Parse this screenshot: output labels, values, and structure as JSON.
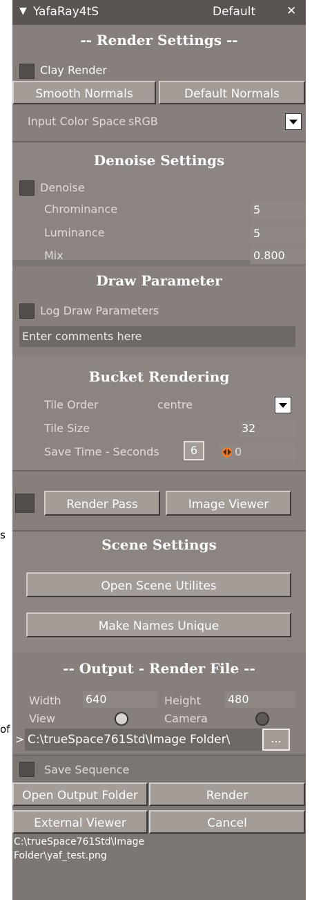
{
  "titlebar": {
    "title": "YafaRay4tS",
    "preset": "Default",
    "close": "✕"
  },
  "stray": {
    "s": "s",
    "of": "of"
  },
  "render_settings": {
    "header": "-- Render Settings --",
    "clay_render": "Clay Render",
    "smooth_normals": "Smooth Normals",
    "default_normals": "Default Normals",
    "input_color_space_label": "Input Color Space",
    "input_color_space_value": "sRGB"
  },
  "denoise": {
    "header": "Denoise Settings",
    "denoise_label": "Denoise",
    "chrominance_label": "Chrominance",
    "chrominance_value": "5",
    "luminance_label": "Luminance",
    "luminance_value": "5",
    "mix_label": "Mix",
    "mix_value": "0.800"
  },
  "draw": {
    "header": "Draw Parameter",
    "log_label": "Log Draw Parameters",
    "comments_placeholder": "Enter comments here"
  },
  "bucket": {
    "header": "Bucket Rendering",
    "tile_order_label": "Tile Order",
    "tile_order_value": "centre",
    "tile_size_label": "Tile Size",
    "tile_size_value": "32",
    "save_time_label": "Save Time - Seconds",
    "save_time_value": "6",
    "counter_value": "0"
  },
  "passes": {
    "render_pass": "Render Pass",
    "image_viewer": "Image Viewer"
  },
  "scene": {
    "header": "Scene Settings",
    "open_utils": "Open Scene Utilites",
    "make_unique": "Make Names Unique"
  },
  "output": {
    "header": "-- Output - Render File --",
    "width_label": "Width",
    "width_value": "640",
    "height_label": "Height",
    "height_value": "480",
    "view_label": "View",
    "camera_label": "Camera",
    "path_prefix": ">",
    "path": "C:\\trueSpace761Std\\Image Folder\\",
    "browse": "...",
    "save_sequence": "Save Sequence",
    "open_folder": "Open Output Folder",
    "render": "Render",
    "external_viewer": "External Viewer",
    "cancel": "Cancel",
    "status_line1": "C:\\trueSpace761Std\\Image",
    "status_line2": "Folder\\yaf_test.png"
  },
  "colors": {
    "panel": "#7c7673",
    "titlebar": "#5a5452",
    "button": "#a49c97",
    "counter_icon": "#ff7a1c"
  }
}
